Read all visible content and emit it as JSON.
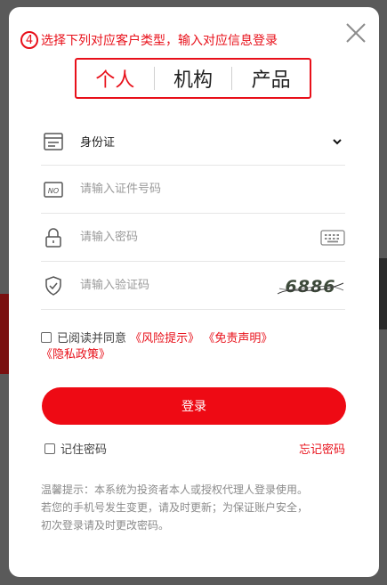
{
  "instruction": {
    "step": "4",
    "text": "选择下列对应客户类型，输入对应信息登录"
  },
  "tabs": [
    {
      "label": "个人",
      "active": true
    },
    {
      "label": "机构",
      "active": false
    },
    {
      "label": "产品",
      "active": false
    }
  ],
  "form": {
    "id_type": {
      "value": "身份证"
    },
    "id_number": {
      "placeholder": "请输入证件号码"
    },
    "password": {
      "placeholder": "请输入密码"
    },
    "captcha": {
      "placeholder": "请输入验证码",
      "code": "6886"
    }
  },
  "agreement": {
    "prefix": "已阅读并同意",
    "risk": "《风险提示》",
    "disclaimer": "《免责声明》",
    "privacy": "《隐私政策》"
  },
  "login_label": "登录",
  "remember_label": "记住密码",
  "forgot_label": "忘记密码",
  "tips": {
    "line1": "温馨提示：本系统为投资者本人或授权代理人登录使用。",
    "line2": "若您的手机号发生变更，请及时更新；为保证账户安全，",
    "line3": "初次登录请及时更改密码。"
  },
  "colors": {
    "accent": "#e8101a",
    "button": "#ee0a14"
  }
}
